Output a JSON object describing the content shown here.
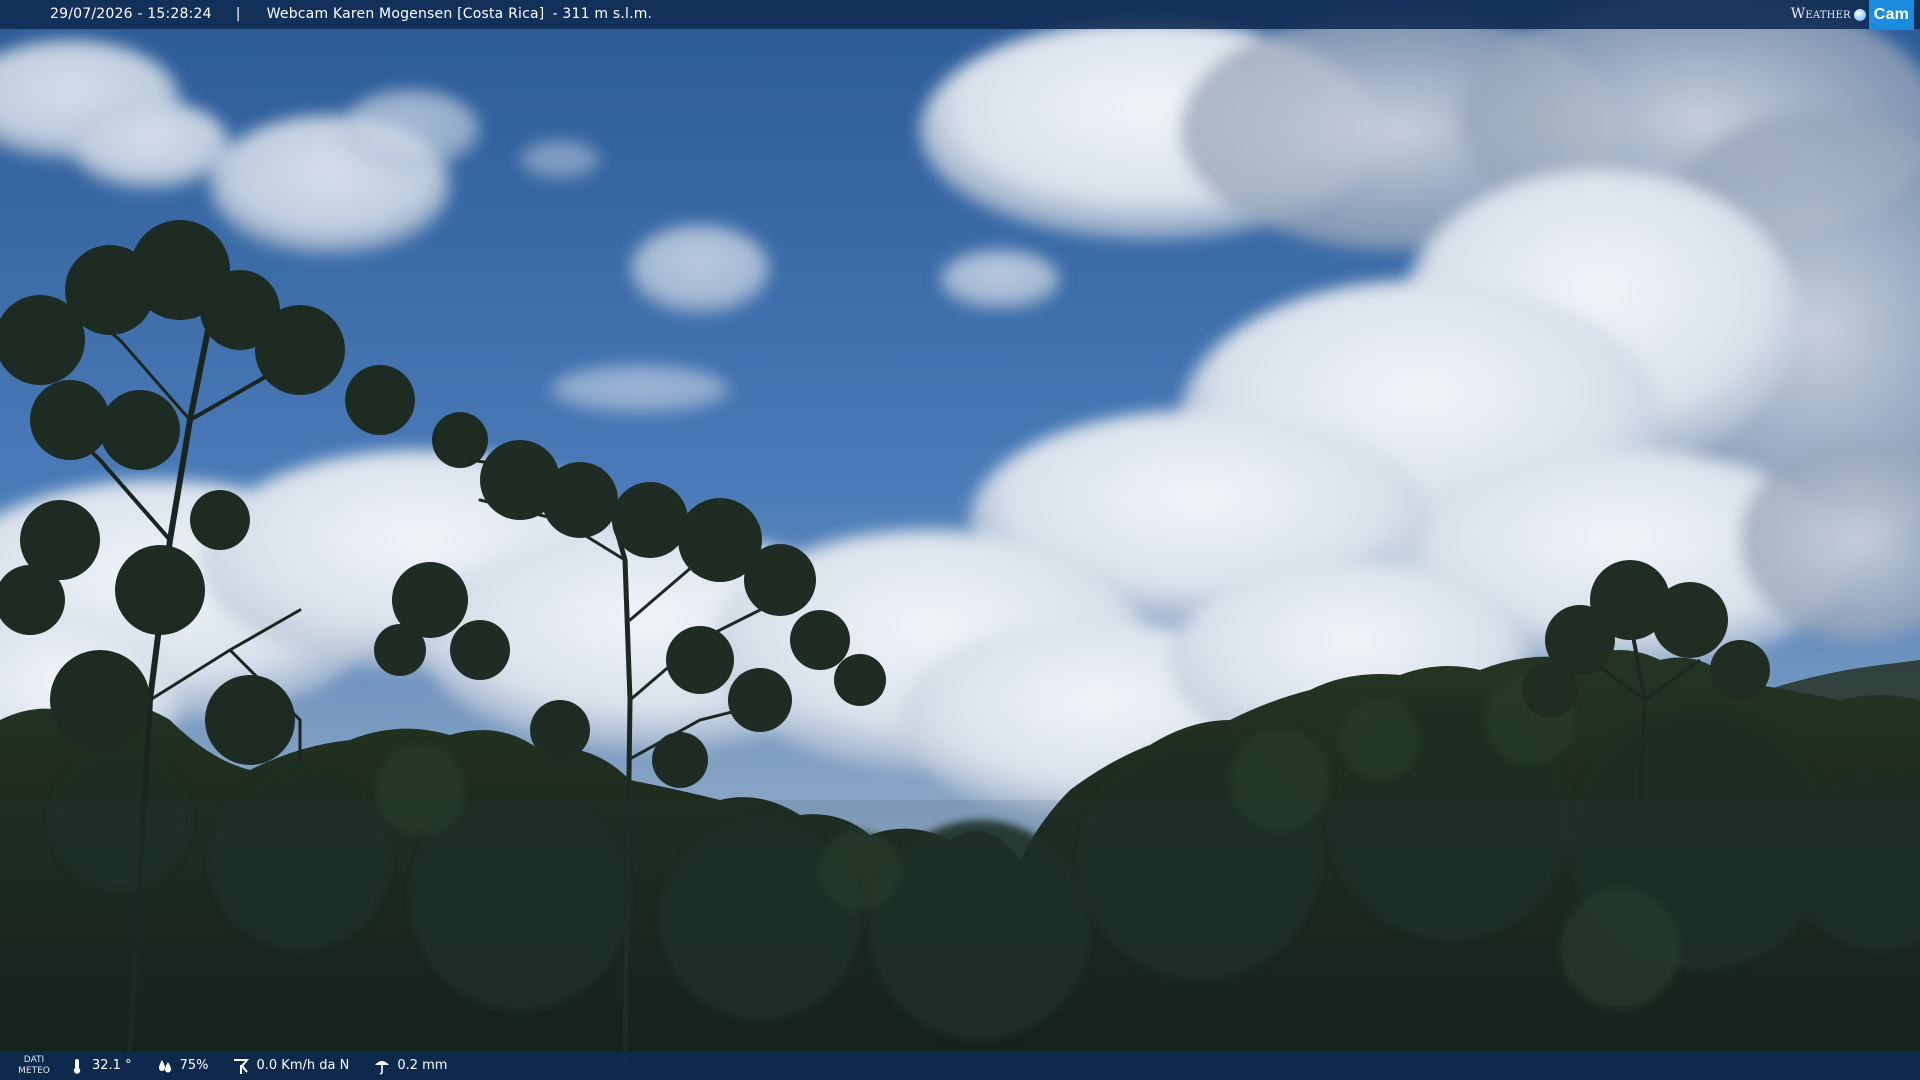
{
  "header": {
    "datetime": "29/07/2026 - 15:28:24",
    "separator": "|",
    "title": "Webcam Karen Mogensen [Costa Rica]",
    "altitude": "- 311 m s.l.m."
  },
  "brand": {
    "weather": "Weather",
    "cam": "Cam",
    "accent_color": "#1b8be0"
  },
  "footer": {
    "label_line1": "DATI",
    "label_line2": "METEO",
    "temperature": "32.1 °",
    "humidity": "75%",
    "wind": "0.0 Km/h da N",
    "rain": "0.2 mm",
    "icons": [
      "thermometer-icon",
      "humidity-icon",
      "wind-icon",
      "rain-icon"
    ]
  },
  "colors": {
    "sky_top": "#2a5a96",
    "sky_mid": "#4677b4",
    "cloud": "#e6ecf3",
    "forest": "#1c2a1e",
    "overlay_bar": "#0e2a52"
  }
}
